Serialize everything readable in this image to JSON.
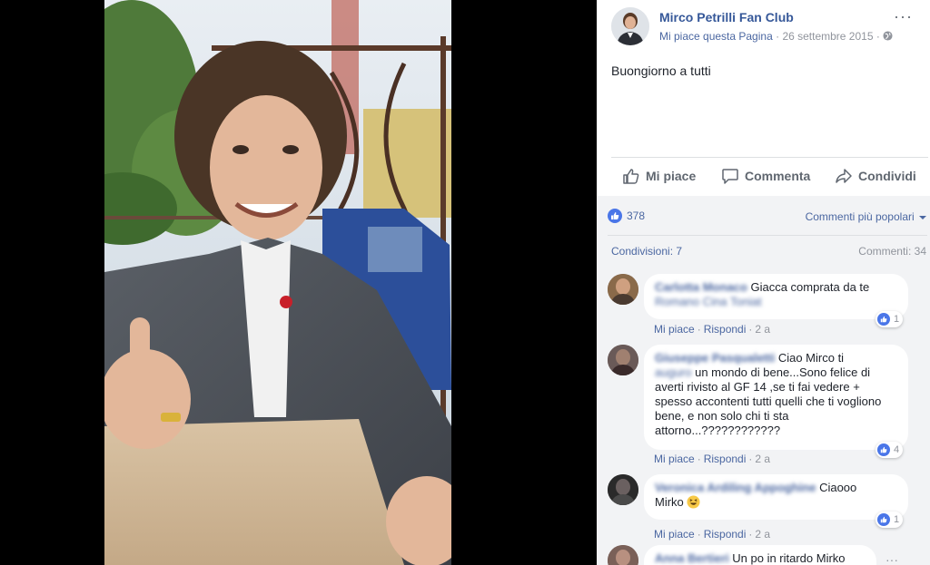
{
  "post": {
    "page_name": "Mirco Petrilli Fan Club",
    "like_page_label": "Mi piace questa Pagina",
    "separator": "·",
    "date": "26 settembre 2015",
    "more_label": "···",
    "text": "Buongiorno a tutti"
  },
  "actions": {
    "like_label": "Mi piace",
    "comment_label": "Commenta",
    "share_label": "Condividi"
  },
  "stats": {
    "reactions_count": "378",
    "sort_label": "Commenti più popolari",
    "shares_label": "Condivisioni: 7",
    "comments_label": "Commenti: 34"
  },
  "comments": [
    {
      "author": "Carlotta Monaco",
      "author_line2": "Romano Cina Toniat",
      "text": "Giacca comprata da te",
      "like_label": "Mi piace",
      "reply_label": "Rispondi",
      "age": "2 a",
      "reactions": "1",
      "avatar_color": "#7a5a40"
    },
    {
      "author": "Giuseppe Pasqualetti",
      "text_line1": "Ciao Mirco ti",
      "text_line2_blur": "auguro",
      "text_line2": " un mondo di bene...Sono felice di",
      "text_rest": "averti rivisto al GF 14 ,se ti fai vedere + spesso accontenti tutti quelli che ti vogliono bene, e non solo chi ti sta attorno...????????????",
      "like_label": "Mi piace",
      "reply_label": "Rispondi",
      "age": "2 a",
      "reactions": "4",
      "avatar_color": "#5a4a48"
    },
    {
      "author": "Veronica Ardiling Appoghine",
      "text_line1": "Ciaooo",
      "text_line2": "Mirko",
      "like_label": "Mi piace",
      "reply_label": "Rispondi",
      "age": "2 a",
      "reactions": "1",
      "avatar_color": "#3a3a3a"
    },
    {
      "author": "Anna Bertieri",
      "text": "Un po in ritardo Mirko",
      "avatar_color": "#6a5048"
    }
  ],
  "colors": {
    "link": "#365899",
    "secondary_link": "#4b67a1",
    "muted": "#90949c",
    "like_blue": "#4a76e8",
    "panel_gray": "#f2f3f5"
  }
}
